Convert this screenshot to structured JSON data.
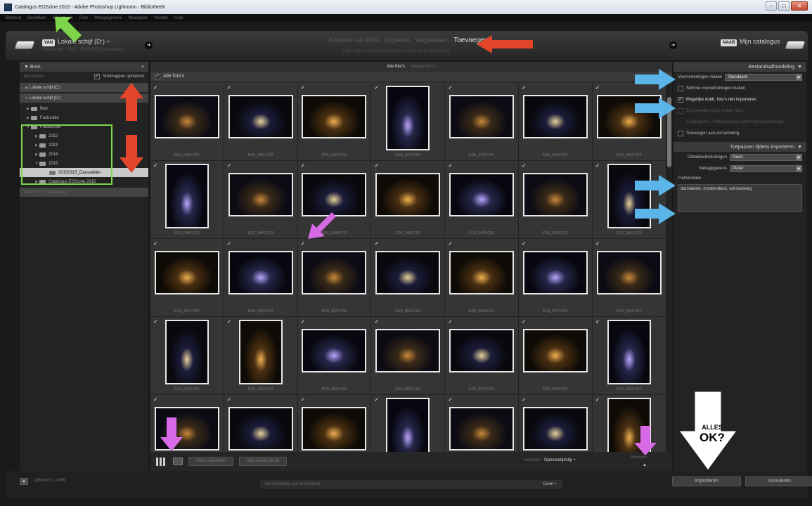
{
  "window": {
    "title": "Catalogus EOSzine 2015 - Adobe Photoshop Lightroom - Bibliotheek",
    "controls": [
      "–",
      "□",
      "✕"
    ]
  },
  "menu": [
    "Bestand",
    "Bewerken",
    "Bibliotheek",
    "Foto",
    "Metagegevens",
    "Weergave",
    "Venster",
    "Help"
  ],
  "import_header": {
    "source_tag": "VAN",
    "source_name": "Lokale schijf (D:) ÷",
    "source_path": "Fotoarchief › 2015 › 20150315_Dansatelier ›",
    "modes": [
      "Kopiëren als DNG",
      "Kopiëren",
      "Verplaatsen",
      "Toevoegen"
    ],
    "active_mode": "Toevoegen",
    "mode_description": "Foto's aan catalogus toevoegen zonder ze te verplaatsen",
    "dest_tag": "NAAR",
    "dest_name": "Mijn catalogus"
  },
  "source_panel": {
    "title": "Bron",
    "files_label": "Bestanden",
    "subfolders_label": "Submappen opnemen",
    "drives": [
      "Lokale schijf (C:)",
      "Lokale schijf (D:)"
    ],
    "tree": [
      {
        "label": "Bob",
        "level": 1,
        "open": false
      },
      {
        "label": "Facturatie",
        "level": 1,
        "open": false
      },
      {
        "label": "Fotoarchief",
        "level": 1,
        "open": true
      },
      {
        "label": "2012",
        "level": 2,
        "open": false
      },
      {
        "label": "2013",
        "level": 2,
        "open": false
      },
      {
        "label": "2014",
        "level": 2,
        "open": false
      },
      {
        "label": "2015",
        "level": 2,
        "open": true
      },
      {
        "label": "20150315_Dansatelier",
        "level": 3,
        "selected": true
      },
      {
        "label": "Catalogus EOSzine 2015",
        "level": 2,
        "open": false
      }
    ],
    "extra_drive": "SECRE (D:) (Opname)"
  },
  "grid": {
    "tabs": [
      "Alle foto's",
      "Nieuwe foto's"
    ],
    "all_photos_label": "Alle foto's",
    "thumbnails": [
      {
        "file": "EOS_0455.CR2",
        "orient": "land"
      },
      {
        "file": "EOS_0461.CR2",
        "orient": "land"
      },
      {
        "file": "EOS_0472.CR2",
        "orient": "land"
      },
      {
        "file": "EOS_0477.CR2",
        "orient": "port"
      },
      {
        "file": "EOS_0479.CR2",
        "orient": "land"
      },
      {
        "file": "EOS_0480.CR2",
        "orient": "land"
      },
      {
        "file": "EOS_0482.CR2",
        "orient": "land"
      },
      {
        "file": "EOS_0486.CR2",
        "orient": "port"
      },
      {
        "file": "EOS_0489.CR2",
        "orient": "land"
      },
      {
        "file": "EOS_0494.CR2",
        "orient": "land"
      },
      {
        "file": "EOS_0498.CR2",
        "orient": "land"
      },
      {
        "file": "EOS_0499.CR2",
        "orient": "land"
      },
      {
        "file": "EOS_0501.CR2",
        "orient": "land"
      },
      {
        "file": "EOS_0509.CR2",
        "orient": "port"
      },
      {
        "file": "EOS_0517.CR2",
        "orient": "land"
      },
      {
        "file": "EOS_0519.CR2",
        "orient": "land"
      },
      {
        "file": "EOS_0520.CR2",
        "orient": "land"
      },
      {
        "file": "EOS_0523.CR2",
        "orient": "land"
      },
      {
        "file": "EOS_0526.CR2",
        "orient": "land"
      },
      {
        "file": "EOS_0527.CR2",
        "orient": "land"
      },
      {
        "file": "EOS_0528.CR2",
        "orient": "land"
      },
      {
        "file": "EOS_0530.CR2",
        "orient": "port"
      },
      {
        "file": "EOS_0532.CR2",
        "orient": "port"
      },
      {
        "file": "EOS_0534.CR2",
        "orient": "land"
      },
      {
        "file": "EOS_0535.CR2",
        "orient": "land"
      },
      {
        "file": "EOS_0537.CR2",
        "orient": "land"
      },
      {
        "file": "EOS_0538.CR2",
        "orient": "land"
      },
      {
        "file": "EOS_0539.CR2",
        "orient": "port"
      },
      {
        "file": "",
        "orient": "land"
      },
      {
        "file": "",
        "orient": "land"
      },
      {
        "file": "",
        "orient": "land"
      },
      {
        "file": "",
        "orient": "port"
      },
      {
        "file": "",
        "orient": "land"
      },
      {
        "file": "",
        "orient": "land"
      },
      {
        "file": "",
        "orient": "port"
      }
    ],
    "toolbar": {
      "check_all": "Alles selecteren",
      "uncheck_all": "Alle deselecteren",
      "sort_label": "Sorteren:",
      "sort_value": "Opnametijdstip ÷",
      "thumb_label": "Miniaturen"
    }
  },
  "file_handling": {
    "title": "Bestandsafhandeling",
    "preview_label": "Voorvertoningen maken",
    "preview_value": "Standaard",
    "smart_preview": "Slimme voorvertoningen maken",
    "no_duplicates": "Mogelijke dubb. foto's niet importeren",
    "second_copy": "Een tweede kopie maken naar:",
    "second_copy_path": "/Gebruikers/.../Afbeeldingen/Lightroom/Gedownload",
    "add_collection": "Toevoegen aan verzameling"
  },
  "apply_during_import": {
    "title": "Toepassen tijdens importeren",
    "develop_label": "Ontwikkelinstellingen",
    "develop_value": "Geen",
    "metadata_label": "Metagegevens",
    "metadata_value": "Pieter",
    "keywords_label": "Trefwoorden",
    "keywords_value": "dansatelier, moderndans, schouwburg"
  },
  "bottom_bar": {
    "count": "186 foto's / 4 GB",
    "preset_label": "Voorinstelling voor importeren",
    "preset_value": "Geen ÷",
    "import_button": "Importeren",
    "cancel_button": "Annuleren"
  },
  "annotation": {
    "line1": "ALLES",
    "line2": "OK?"
  }
}
